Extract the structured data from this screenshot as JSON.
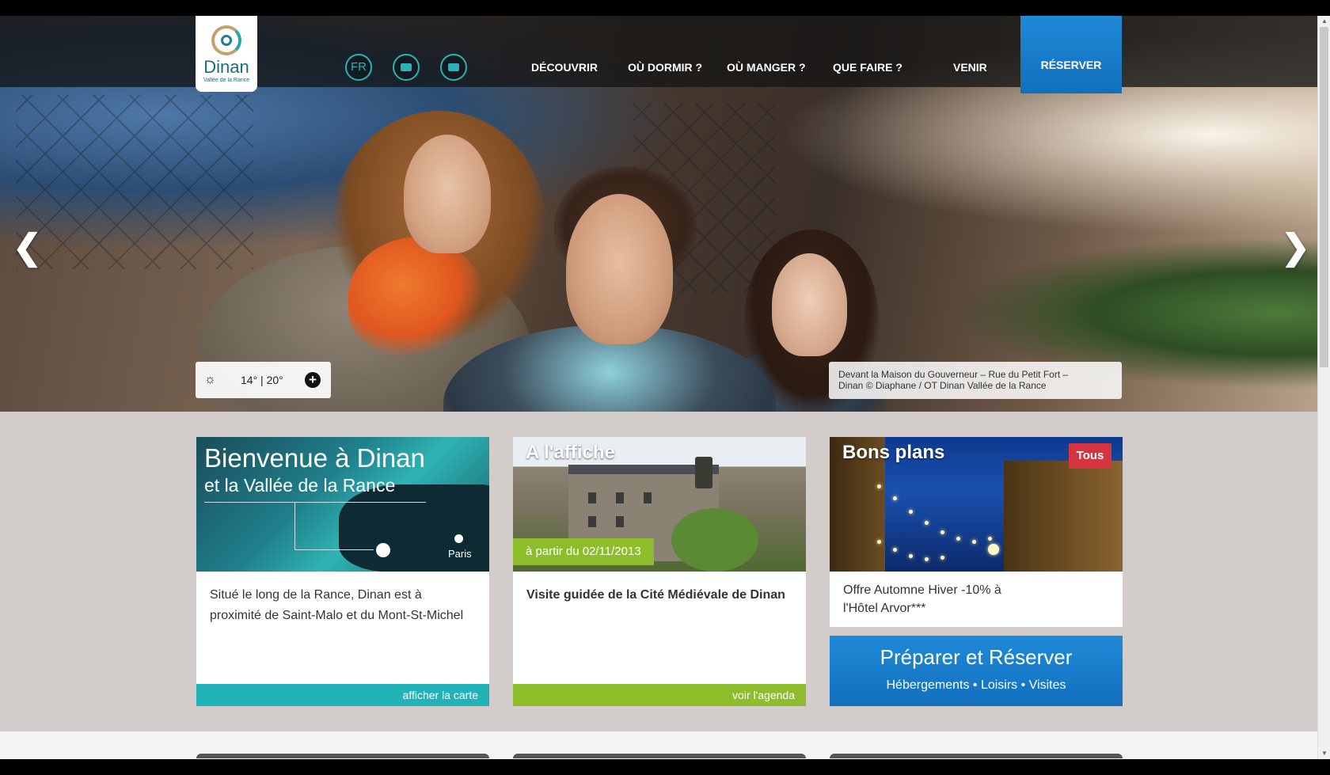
{
  "header": {
    "logo": {
      "name": "Dinan",
      "subtitle": "Vallée de la Rance"
    },
    "language": "FR",
    "icons": [
      "suitcase-icon",
      "mail-icon"
    ],
    "nav": [
      "DÉCOUVRIR",
      "OÙ DORMIR ?",
      "OÙ MANGER ?",
      "QUE FAIRE ?",
      "VENIR"
    ],
    "reserve_label": "RÉSERVER"
  },
  "hero": {
    "prev": "❮",
    "next": "❯",
    "weather": {
      "temp": "14° | 20°",
      "plus": "+"
    },
    "caption_line1": "Devant la Maison du Gouverneur – Rue du Petit Fort –",
    "caption_line2": "Dinan © Diaphane / OT Dinan Vallée de la Rance"
  },
  "cards": {
    "welcome": {
      "title_line1": "Bienvenue à Dinan",
      "title_line2": "et la Vallée de la Rance",
      "map_label": "Paris",
      "text": "Situé le long de la Rance, Dinan est à proximité de Saint-Malo et du Mont-St-Michel",
      "footer": "afficher la carte"
    },
    "agenda": {
      "title": "A l'affiche",
      "date": "à partir du 02/11/2013",
      "text": "Visite guidée de la Cité Médiévale de Dinan",
      "footer": "voir l'agenda"
    },
    "deals": {
      "title": "Bons plans",
      "badge": "Tous",
      "text_line1": "Offre Automne Hiver -10% à",
      "text_line2": "l'Hôtel Arvor***"
    }
  },
  "prepare": {
    "title": "Préparer et Réserver",
    "subtitle": "Hébergements • Loisirs • Visites"
  },
  "colors": {
    "accent_blue": "#1a80cf",
    "teal": "#21b3b8",
    "green": "#8ebd2b",
    "red_badge": "#d8343f",
    "page_bg": "#d2ccca"
  }
}
